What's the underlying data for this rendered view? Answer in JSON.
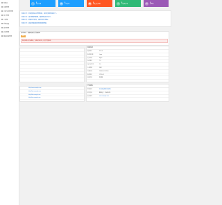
{
  "sidebar": {
    "items": [
      {
        "label": "控制台"
      },
      {
        "label": "内容管理"
      },
      {
        "label": "订单与财务管理"
      },
      {
        "label": "用户管理"
      },
      {
        "label": "工具箱"
      },
      {
        "label": "系统设置"
      },
      {
        "label": "插件管理"
      },
      {
        "label": "会员管理"
      },
      {
        "label": "模板风格管理"
      }
    ]
  },
  "stats": [
    {
      "value": "0",
      "label": "待付订单",
      "color": "#1e9fff",
      "icon": "cart-icon"
    },
    {
      "value": "0",
      "label": "今日订单",
      "color": "#1e9fff",
      "icon": "doc-icon"
    },
    {
      "value": "0",
      "label": "待发货订单数",
      "color": "#ff5722",
      "icon": "truck-icon"
    },
    {
      "value": "0",
      "label": "已完成订单",
      "color": "#2fb976",
      "icon": "check-icon"
    },
    {
      "value": "0",
      "label": "待退款",
      "color": "#9b59b6",
      "icon": "refund-icon"
    }
  ],
  "notices": [
    "系统公告：欢迎使用后台管理系统，请及时更新系统补丁。",
    "系统公告：请定期备份数据，确保网站安全运行。",
    "系统公告：新版本已发布，请前往官方查看。",
    "系统公告：如遇问题请联系客服获取帮助。"
  ],
  "alert": {
    "title": "安全提示 - 请修改默认后台路径",
    "badge": "安全",
    "warning": "检测到默认后台路径，存在安全风险，建议尽快修改。"
  },
  "left_panel": {
    "rows": [
      "",
      "",
      "",
      "",
      "",
      "",
      "",
      "",
      ""
    ]
  },
  "info_panel": {
    "title": "系统信息",
    "rows": [
      {
        "k": "程序版本",
        "v": "V1.0.0"
      },
      {
        "k": "服务器系统",
        "v": "Linux"
      },
      {
        "k": "运行环境",
        "v": "Nginx"
      },
      {
        "k": "PHP版本",
        "v": "7.3"
      },
      {
        "k": "MySQL版本",
        "v": "5.6"
      },
      {
        "k": "上传限制",
        "v": "50M"
      },
      {
        "k": "当前时间",
        "v": "2024-01-01 12:00"
      },
      {
        "k": "服务器IP",
        "v": "127.0.0.1"
      },
      {
        "k": "授权状态",
        "v": "免费版"
      }
    ]
  },
  "left_panel2": {
    "links": [
      "http://www.example.com",
      "http://help.example.com",
      "http://bbs.example.com",
      "http://doc.example.com"
    ]
  },
  "link_panel": {
    "title": "开发团队",
    "rows": [
      {
        "k": "版权所有",
        "v": "后台管理系统开发团队",
        "link": true
      },
      {
        "k": "技术支持",
        "v": "客服QQ：123456789"
      },
      {
        "k": "官方网站",
        "v": "www.example.com",
        "link": true
      }
    ]
  }
}
